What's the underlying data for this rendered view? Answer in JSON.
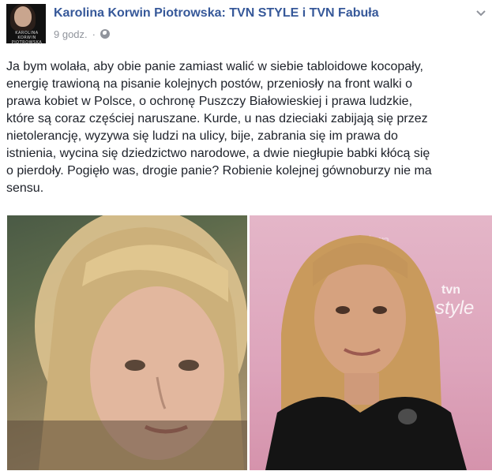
{
  "post": {
    "author": "Karolina Korwin Piotrowska: TVN STYLE i TVN Fabuła",
    "time": "9 godz.",
    "meta_separator": "·",
    "privacy_icon": "globe-icon",
    "menu_icon": "chevron-down-icon",
    "avatar_caption": "KAROLINA KORWIN PIOTROWSKA",
    "text_lines": [
      "Ja bym wolała, aby obie panie zamiast walić w siebie tabloidowe kocopały,",
      "energię trawioną na pisanie kolejnych postów, przeniosły na front walki o",
      "prawa kobiet w Polsce, o ochronę Puszczy Białowieskiej i prawa ludzkie,",
      "które są coraz częściej naruszane. Kurde, u nas dzieciaki zabijają się przez",
      "nietolerancję, wyzywa się ludzi na ulicy, bije, zabrania się im prawa do",
      "istnienia, wycina się dziedzictwo narodowe, a dwie niegłupie babki kłócą się",
      "o pierdoły. Pogięło was, drogie panie? Robienie kolejnej gównoburzy nie ma",
      "sensu."
    ],
    "photo_right_logo_top": "tvn",
    "photo_right_logo_bottom": "style"
  },
  "colors": {
    "author_link": "#365899",
    "meta_gray": "#90949c",
    "text": "#1d2129",
    "photo_right_background": "#dda4bb"
  }
}
